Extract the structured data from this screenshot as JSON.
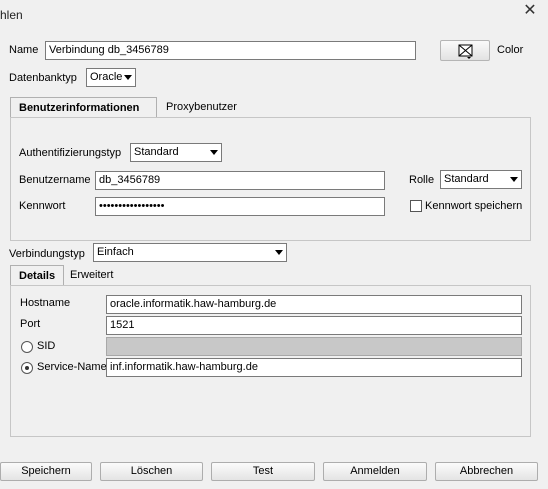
{
  "window": {
    "title": "hlen",
    "close_icon": "close-icon"
  },
  "name": {
    "label": "Name",
    "value": "Verbindung db_3456789"
  },
  "color": {
    "label": "Color",
    "icon": "color-picker-icon"
  },
  "db_type": {
    "label": "Datenbanktyp",
    "value": "Oracle"
  },
  "tabs_top": [
    {
      "label": "Benutzerinformationen",
      "selected": true
    },
    {
      "label": "Proxybenutzer",
      "selected": false
    }
  ],
  "auth": {
    "label": "Authentifizierungstyp",
    "value": "Standard"
  },
  "user": {
    "label": "Benutzername",
    "value": "db_3456789"
  },
  "role": {
    "label": "Rolle",
    "value": "Standard"
  },
  "password": {
    "label": "Kennwort",
    "value": "•••••••••••••••••"
  },
  "save_password": {
    "label": "Kennwort speichern",
    "checked": false
  },
  "conn_type": {
    "label": "Verbindungstyp",
    "value": "Einfach"
  },
  "tabs_conn": [
    {
      "label": "Details",
      "selected": true
    },
    {
      "label": "Erweitert",
      "selected": false
    }
  ],
  "details": {
    "hostname": {
      "label": "Hostname",
      "value": "oracle.informatik.haw-hamburg.de"
    },
    "port": {
      "label": "Port",
      "value": "1521"
    },
    "sid": {
      "label": "SID",
      "value": "",
      "selected": false
    },
    "service": {
      "label": "Service-Name",
      "value": "inf.informatik.haw-hamburg.de",
      "selected": true
    }
  },
  "buttons": {
    "save": "Speichern",
    "delete": "Löschen",
    "test": "Test",
    "login": "Anmelden",
    "cancel": "Abbrechen"
  }
}
